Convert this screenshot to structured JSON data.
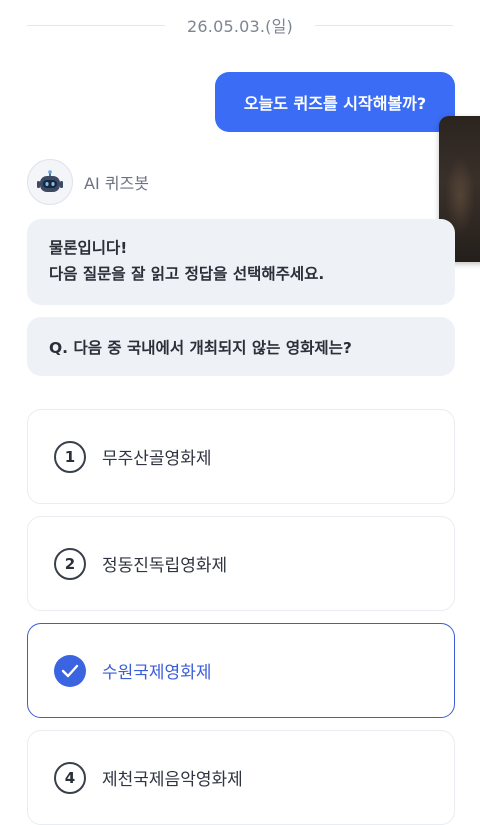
{
  "date_divider": "26.05.03.(일)",
  "user_message": "오늘도 퀴즈를 시작해볼까?",
  "bot": {
    "name": "AI 퀴즈봇",
    "avatar_icon": "robot-icon",
    "message_lines": [
      "물론입니다!",
      "다음 질문을 잘 읽고 정답을 선택해주세요."
    ],
    "question": "Q. 다음 중 국내에서 개최되지 않는 영화제는?"
  },
  "options": [
    {
      "number": "1",
      "label": "무주산골영화제",
      "selected": false
    },
    {
      "number": "2",
      "label": "정동진독립영화제",
      "selected": false
    },
    {
      "number": "3",
      "label": "수원국제영화제",
      "selected": true
    },
    {
      "number": "4",
      "label": "제천국제음악영화제",
      "selected": false
    }
  ],
  "colors": {
    "accent": "#3b6cf5",
    "selected_border": "#3b5ed8",
    "card_bg": "#eef1f6"
  }
}
